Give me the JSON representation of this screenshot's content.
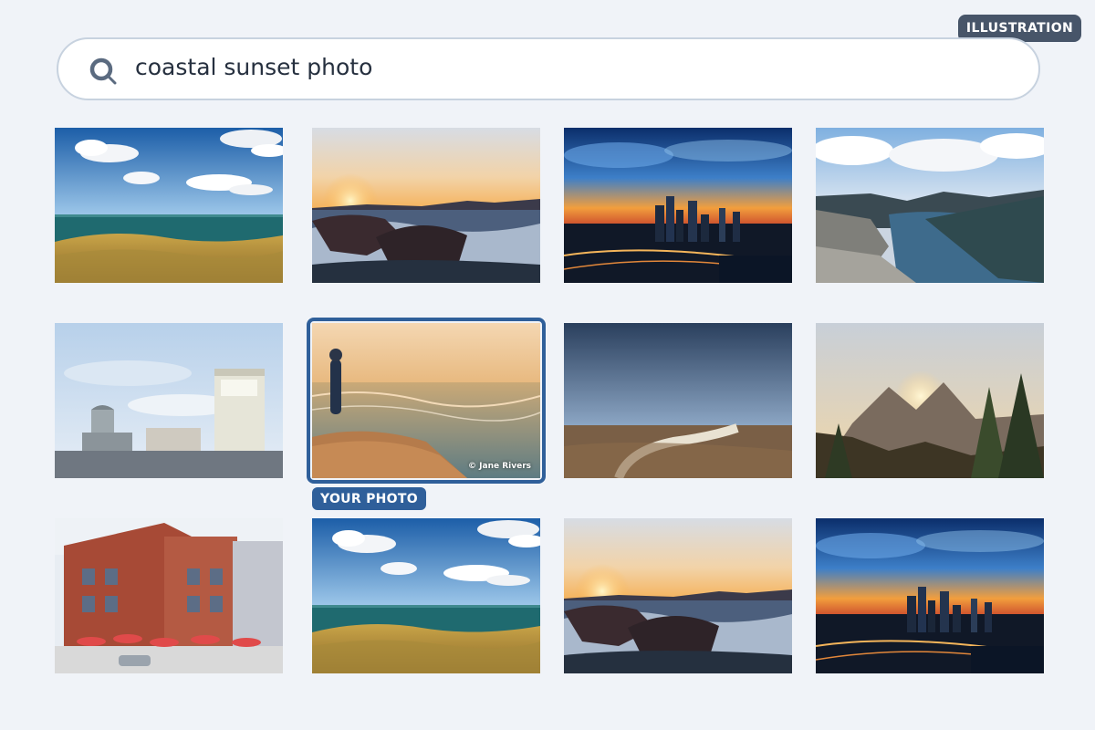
{
  "badge": {
    "label": "ILLUSTRATION"
  },
  "search": {
    "query": "coastal sunset photo"
  },
  "selected": {
    "tag": "YOUR PHOTO",
    "credit": "© Jane Rivers"
  },
  "grid": {
    "tiles": [
      {
        "icon": "coastal-grassland"
      },
      {
        "icon": "sunset-rocky-shore"
      },
      {
        "icon": "city-sunset-aerial"
      },
      {
        "icon": "fjord-cliffs"
      },
      {
        "icon": "industrial-silos"
      },
      {
        "icon": "person-watching-surf"
      },
      {
        "icon": "country-road-field"
      },
      {
        "icon": "forest-sunset-mountain"
      },
      {
        "icon": "brick-building-cafe"
      },
      {
        "icon": "coastal-grassland"
      },
      {
        "icon": "sunset-rocky-shore"
      },
      {
        "icon": "city-sunset-aerial"
      }
    ]
  }
}
